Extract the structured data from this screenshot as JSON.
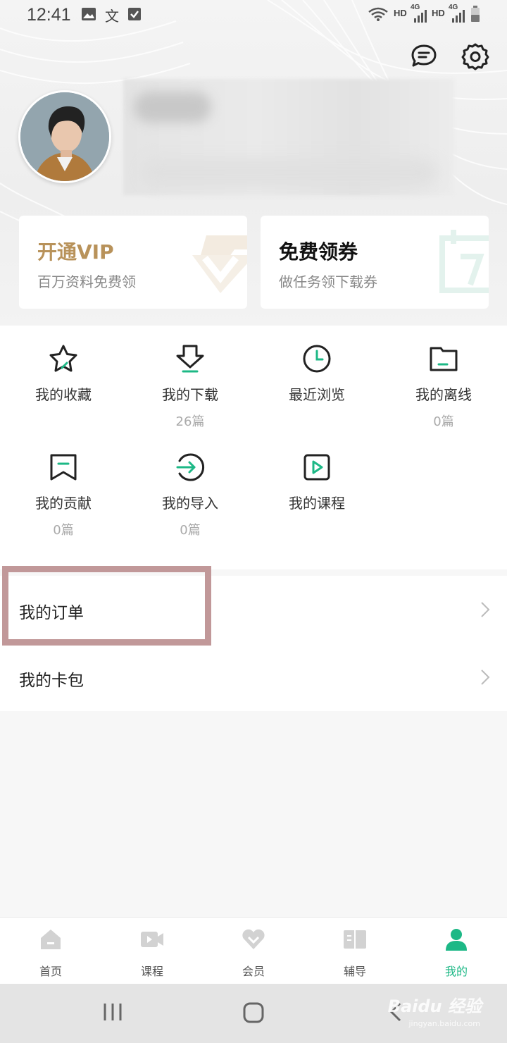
{
  "status_bar": {
    "time": "12:41",
    "text_icon": "文",
    "network_1": "HD",
    "network_gen_1": "4G",
    "network_2": "HD",
    "network_gen_2": "4G",
    "icons": [
      "image-icon",
      "text-icon",
      "check-icon",
      "wifi-icon",
      "signal-icon",
      "battery-icon"
    ]
  },
  "header": {
    "icons": [
      "message-icon",
      "settings-icon"
    ]
  },
  "promo_cards": [
    {
      "title": "开通VIP",
      "subtitle": "百万资料免费领",
      "title_color": "#b8925a",
      "icon": "vip-diamond-icon"
    },
    {
      "title": "免费领券",
      "subtitle": "做任务领下载券",
      "title_color": "#111111",
      "icon": "calendar-7-icon"
    }
  ],
  "grid": [
    {
      "label": "我的收藏",
      "count": "",
      "icon": "star-icon"
    },
    {
      "label": "我的下载",
      "count": "26篇",
      "icon": "download-icon"
    },
    {
      "label": "最近浏览",
      "count": "",
      "icon": "clock-icon"
    },
    {
      "label": "我的离线",
      "count": "0篇",
      "icon": "folder-icon"
    },
    {
      "label": "我的贡献",
      "count": "0篇",
      "icon": "bookmark-icon"
    },
    {
      "label": "我的导入",
      "count": "0篇",
      "icon": "import-icon"
    },
    {
      "label": "我的课程",
      "count": "",
      "icon": "play-icon"
    }
  ],
  "list": [
    {
      "label": "我的订单"
    },
    {
      "label": "我的卡包"
    }
  ],
  "tabs": [
    {
      "label": "首页",
      "icon": "home-icon",
      "active": false
    },
    {
      "label": "课程",
      "icon": "video-icon",
      "active": false
    },
    {
      "label": "会员",
      "icon": "vip-heart-icon",
      "active": false
    },
    {
      "label": "辅导",
      "icon": "book-icon",
      "active": false
    },
    {
      "label": "我的",
      "icon": "person-icon",
      "active": true
    }
  ],
  "colors": {
    "accent": "#1db886",
    "vip_gold": "#b8925a",
    "highlight_border": "#c19899",
    "tab_inactive_icon": "#cfcfcf"
  },
  "watermark": {
    "main": "Baidu 经验",
    "sub": "jingyan.baidu.com"
  }
}
